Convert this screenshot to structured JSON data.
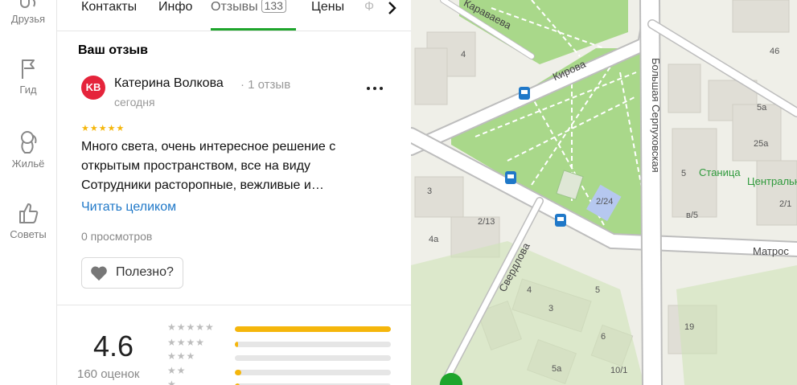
{
  "nav": [
    {
      "label": "Друзья",
      "icon": "friends-icon"
    },
    {
      "label": "Гид",
      "icon": "flag-icon"
    },
    {
      "label": "Жильё",
      "icon": "housing-icon"
    },
    {
      "label": "Советы",
      "icon": "thumbs-up-icon"
    }
  ],
  "tabs": {
    "contacts": "Контакты",
    "info": "Инфо",
    "reviews": "Отзывы",
    "reviews_count": "133",
    "prices": "Цены",
    "faded": "Ф"
  },
  "review": {
    "section_title": "Ваш отзыв",
    "avatar_initials": "KB",
    "author": "Катерина Волкова",
    "count": "· 1 отзыв",
    "date": "сегодня",
    "stars": "★★★★★",
    "rating_value": 5,
    "text_line1": "Много света, очень интересное решение с",
    "text_line2": "открытым пространством, все на виду",
    "text_line3": "Сотрудники расторопные, вежливые и…",
    "read_more": "Читать целиком",
    "views": "0 просмотров",
    "useful": "Полезно?",
    "more_icon": "more-dots-icon",
    "useful_icon": "heart-icon"
  },
  "summary": {
    "rating": "4.6",
    "count": "160 оценок",
    "distribution": [
      {
        "stars": 5,
        "label": "★★★★★",
        "share": 1.0
      },
      {
        "stars": 4,
        "label": "★★★★",
        "share": 0.02
      },
      {
        "stars": 3,
        "label": "★★★",
        "share": 0.0
      },
      {
        "stars": 2,
        "label": "★★",
        "share": 0.04
      },
      {
        "stars": 1,
        "label": "★",
        "share": 0.03
      }
    ]
  },
  "map": {
    "streets": [
      "Караваева",
      "Кирова",
      "Большая Серпуховская",
      "Свердлова",
      "Матрос"
    ],
    "houses": [
      "4",
      "46",
      "5а",
      "25а",
      "5",
      "в/5",
      "2/1",
      "3",
      "2/13",
      "4а",
      "2/24",
      "5",
      "6",
      "4",
      "3",
      "19",
      "5а",
      "10/1"
    ],
    "pois": [
      "Станица",
      "Центральн"
    ],
    "colors": {
      "park": "#a9d88a",
      "road": "#ffffff",
      "road_edge": "#bdbdbd",
      "bg": "#efefe8",
      "building": "#e0ded6",
      "transit": "#1f78c8",
      "accent": "#1ea52c"
    }
  }
}
